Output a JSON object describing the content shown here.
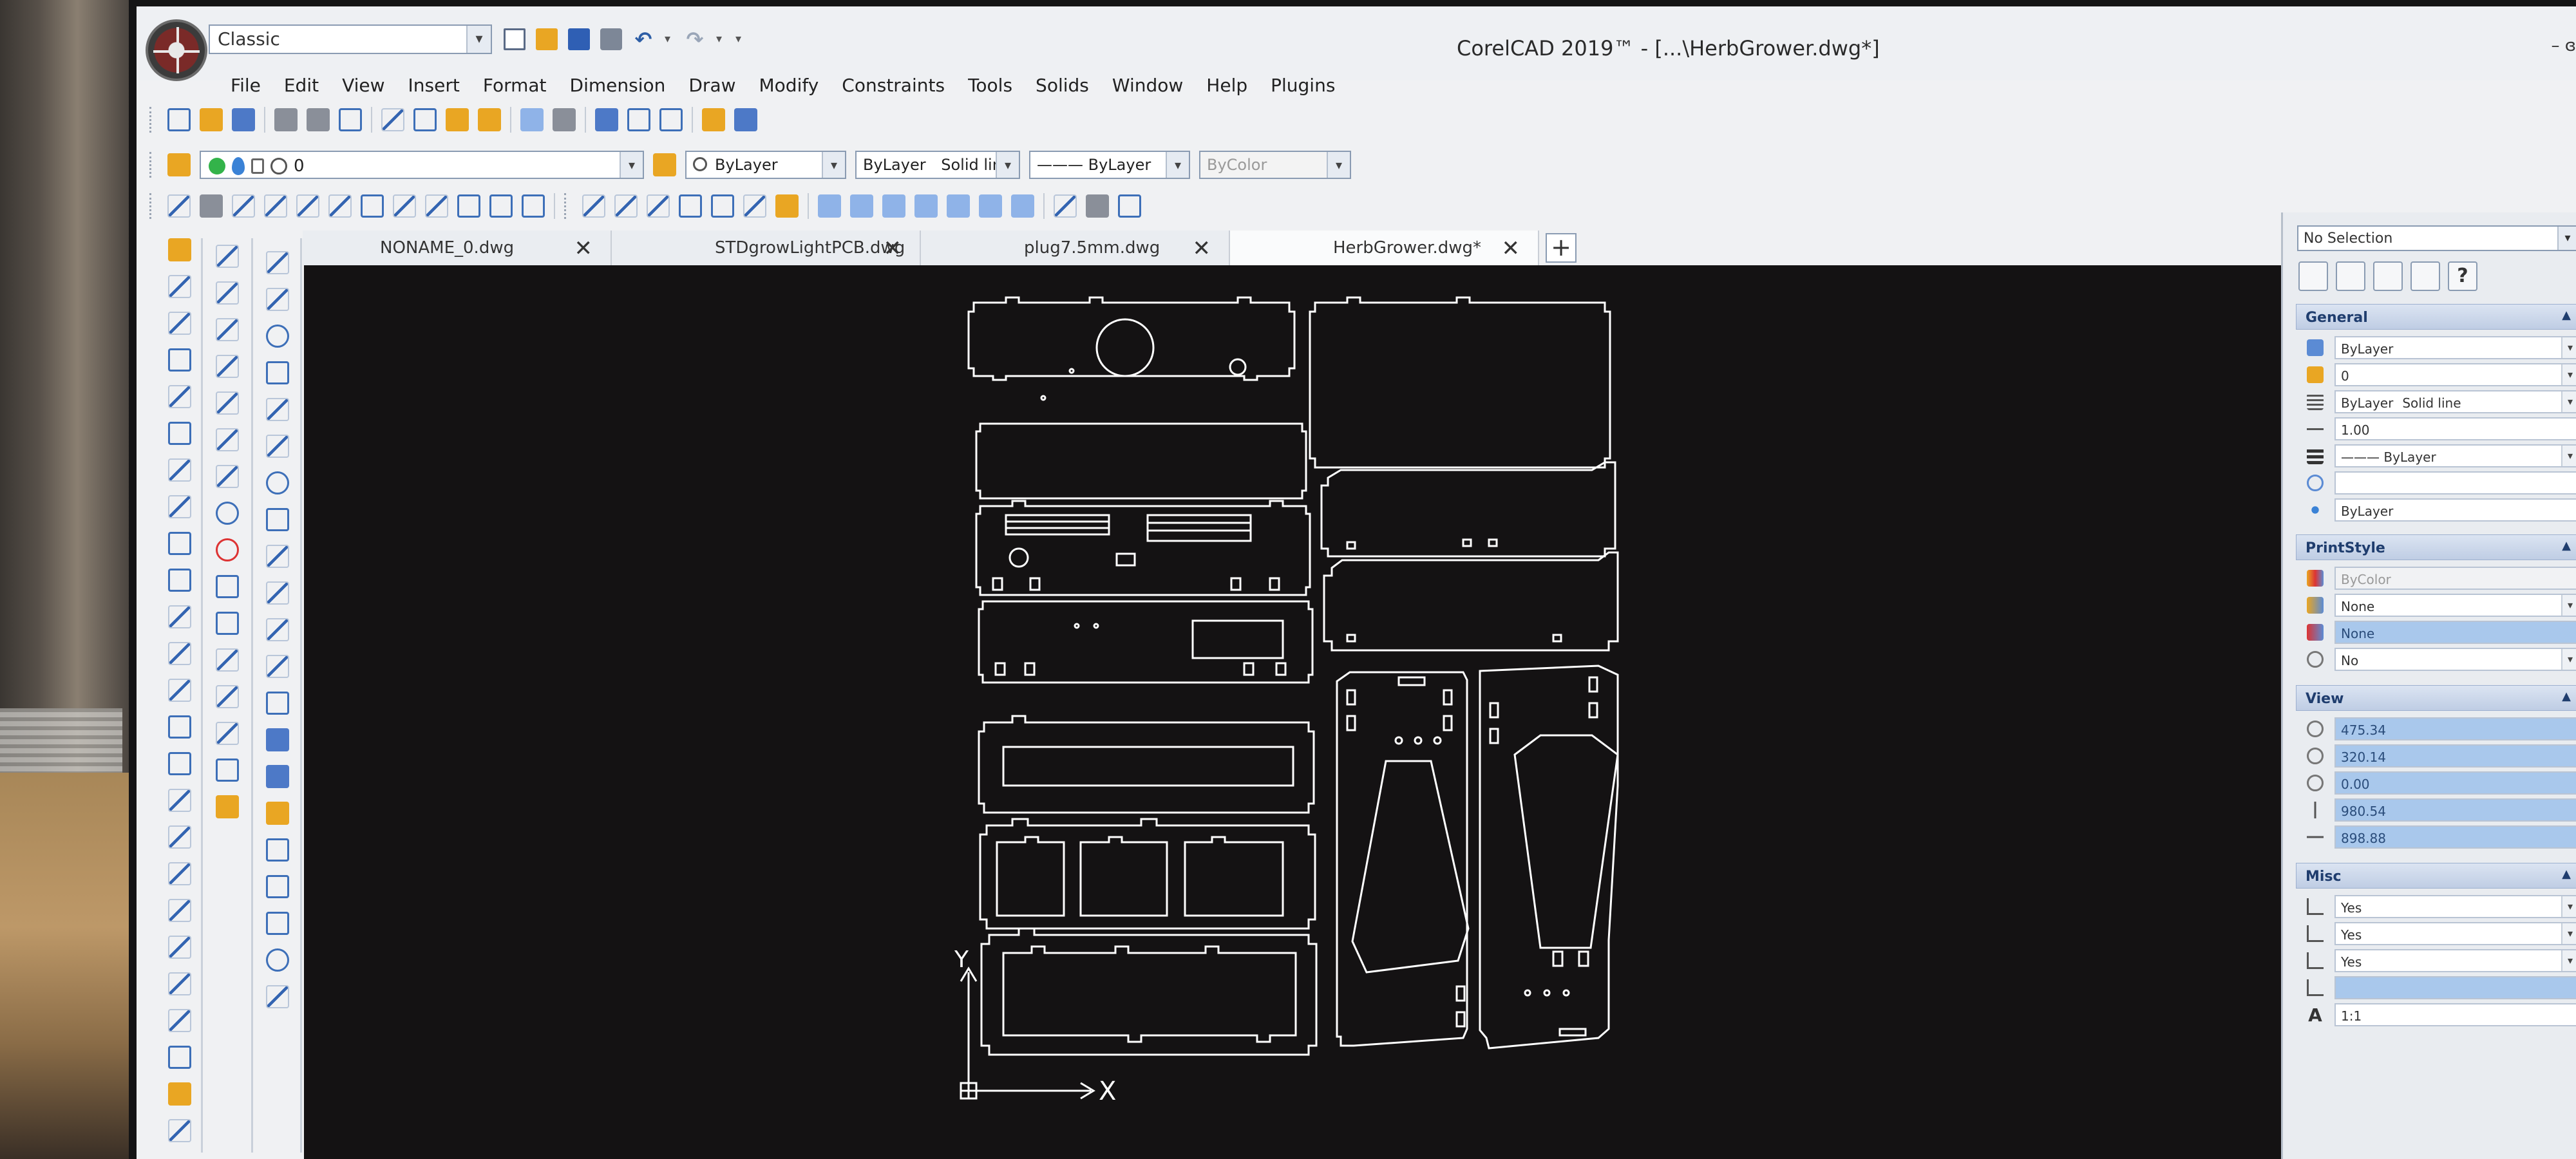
{
  "window": {
    "title": "CorelCAD 2019™ - [...\\HerbGrower.dwg*]",
    "controls": "– ɞ",
    "workspace": "Classic"
  },
  "menu": [
    "File",
    "Edit",
    "View",
    "Insert",
    "Format",
    "Dimension",
    "Draw",
    "Modify",
    "Constraints",
    "Tools",
    "Solids",
    "Window",
    "Help",
    "Plugins"
  ],
  "layer_bar": {
    "layer": "0",
    "color": "ByLayer",
    "linestyle_layer": "ByLayer",
    "linestyle_name": "Solid line",
    "lineweight": "——— ByLayer",
    "printstyle": "ByColor"
  },
  "tabs": [
    {
      "label": "NONAME_0.dwg",
      "active": false
    },
    {
      "label": "STDgrowLightPCB.dwg",
      "active": false
    },
    {
      "label": "plug7.5mm.dwg",
      "active": false
    },
    {
      "label": "HerbGrower.dwg*",
      "active": true
    }
  ],
  "tab_close": "✕",
  "tab_add": "+",
  "properties": {
    "selection": "No Selection",
    "help": "?",
    "general_title": "General",
    "general": {
      "color": "ByLayer",
      "layer": "0",
      "linestyle_layer": "ByLayer",
      "linestyle_name": "Solid line",
      "scale": "1.00",
      "lineweight": "——— ByLayer",
      "hyperlink": "",
      "transparency": "ByLayer"
    },
    "printstyle_title": "PrintStyle",
    "printstyle": {
      "style": "ByColor",
      "table": "None",
      "space": "None",
      "attached": "No"
    },
    "view_title": "View",
    "view": {
      "center_x": "475.34",
      "center_y": "320.14",
      "center_z": "0.00",
      "height": "980.54",
      "width": "898.88"
    },
    "misc_title": "Misc",
    "misc": {
      "ucs_icon_on": "Yes",
      "ucs_at_origin": "Yes",
      "ucs_per_viewport": "Yes",
      "ucs_name": "",
      "annotation_scale": "1:1"
    }
  },
  "canvas": {
    "axis_x": "X",
    "axis_y": "Y"
  },
  "colors": {
    "canvas_bg": "#141213",
    "drawing_lines": "#ffffff",
    "accent": "#4d79c7",
    "highlight": "#a9c8ec"
  }
}
